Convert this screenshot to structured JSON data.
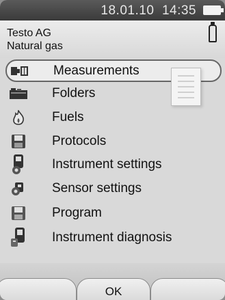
{
  "status": {
    "date": "18.01.10",
    "time": "14:35"
  },
  "header": {
    "company": "Testo AG",
    "fuel": "Natural gas"
  },
  "menu": {
    "items": [
      {
        "label": "Measurements",
        "icon": "measurements-icon",
        "selected": true
      },
      {
        "label": "Folders",
        "icon": "folders-icon"
      },
      {
        "label": "Fuels",
        "icon": "flame-icon"
      },
      {
        "label": "Protocols",
        "icon": "floppy-icon"
      },
      {
        "label": "Instrument settings",
        "icon": "instrument-settings-icon"
      },
      {
        "label": "Sensor settings",
        "icon": "sensor-settings-icon"
      },
      {
        "label": "Program",
        "icon": "program-icon"
      },
      {
        "label": "Instrument diagnosis",
        "icon": "instrument-diagnosis-icon"
      }
    ]
  },
  "softkeys": {
    "left": "",
    "center": "OK",
    "right": ""
  }
}
